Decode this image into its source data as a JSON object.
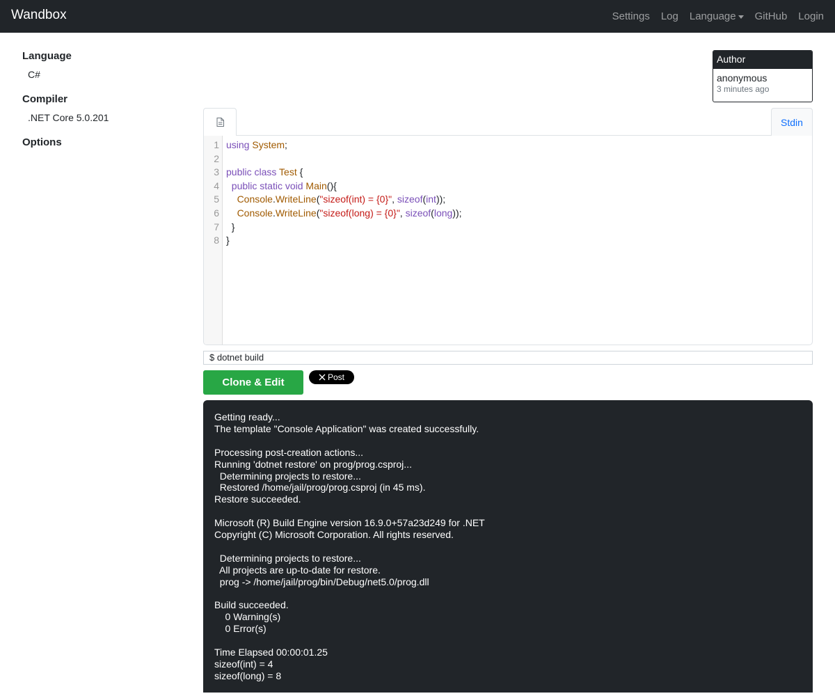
{
  "navbar": {
    "brand": "Wandbox",
    "links": {
      "settings": "Settings",
      "log": "Log",
      "language": "Language",
      "github": "GitHub",
      "login": "Login"
    }
  },
  "sidebar": {
    "language_heading": "Language",
    "language_value": "C#",
    "compiler_heading": "Compiler",
    "compiler_value": ".NET Core 5.0.201",
    "options_heading": "Options"
  },
  "author": {
    "heading": "Author",
    "name": "anonymous",
    "time": "3 minutes ago"
  },
  "editor": {
    "file_tab_icon": "file-icon",
    "stdin_tab": "Stdin",
    "line_numbers": [
      "1",
      "2",
      "3",
      "4",
      "5",
      "6",
      "7",
      "8"
    ]
  },
  "command": "$ dotnet build",
  "buttons": {
    "clone_edit": "Clone & Edit",
    "post": "Post",
    "post_icon": "x-logo-icon"
  },
  "output_lines": [
    "Getting ready...",
    "The template \"Console Application\" was created successfully.",
    "",
    "Processing post-creation actions...",
    "Running 'dotnet restore' on prog/prog.csproj...",
    "  Determining projects to restore...",
    "  Restored /home/jail/prog/prog.csproj (in 45 ms).",
    "Restore succeeded.",
    "",
    "Microsoft (R) Build Engine version 16.9.0+57a23d249 for .NET",
    "Copyright (C) Microsoft Corporation. All rights reserved.",
    "",
    "  Determining projects to restore...",
    "  All projects are up-to-date for restore.",
    "  prog -> /home/jail/prog/bin/Debug/net5.0/prog.dll",
    "",
    "Build succeeded.",
    "    0 Warning(s)",
    "    0 Error(s)",
    "",
    "Time Elapsed 00:00:01.25",
    "sizeof(int) = 4",
    "sizeof(long) = 8"
  ],
  "colors": {
    "navbar_bg": "#212529",
    "clone_button": "#28a745",
    "stdin_link": "#0d6efd"
  }
}
